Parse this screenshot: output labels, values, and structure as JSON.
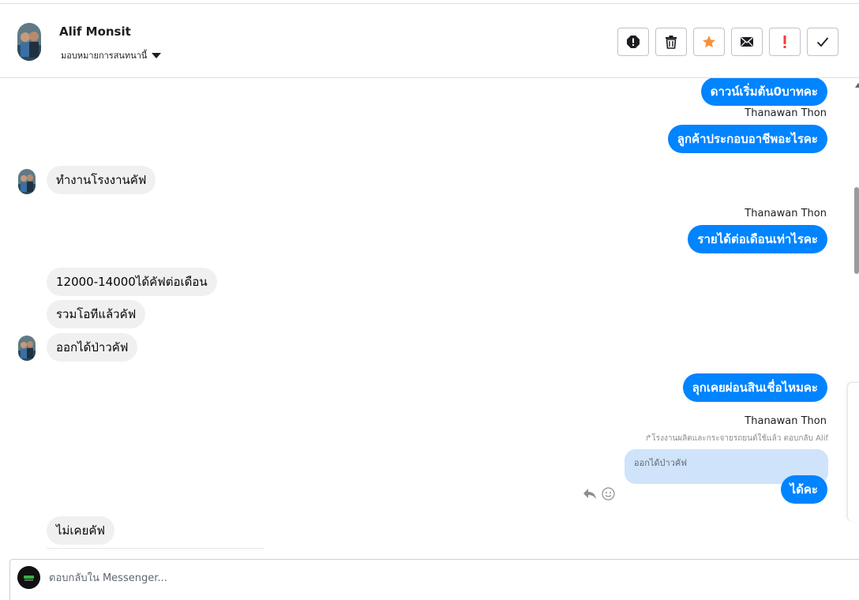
{
  "header": {
    "contact_name": "Alif Monsit",
    "assign_label": "มอบหมายการสนทนานี้",
    "actions": [
      {
        "name": "spam-button",
        "icon": "alert-circle-icon"
      },
      {
        "name": "delete-button",
        "icon": "trash-icon"
      },
      {
        "name": "star-button",
        "icon": "star-icon",
        "color": "#f7923b"
      },
      {
        "name": "email-button",
        "icon": "envelope-icon"
      },
      {
        "name": "follow-up-button",
        "icon": "exclamation-icon",
        "color": "#fa383e"
      },
      {
        "name": "done-button",
        "icon": "checkmark-icon"
      }
    ]
  },
  "messages": {
    "out1": "ดาวน์เริ่มต้น0บาทคะ",
    "sender1": "Thanawan Thon",
    "out2": "ลูกค้าประกอบอาชีพอะไรคะ",
    "in1": "ทำงานโรงงานคัฟ",
    "sender2": "Thanawan Thon",
    "out3": "รายได้ต่อเดือนเท่าไรคะ",
    "in2": "12000-14000ได้คัฟต่อเดือน",
    "in3": "รวมโอทีแล้วคัฟ",
    "in4": "ออกได้ป่าวคัฟ",
    "out4": "ลุกเคยผ่อนสินเชื่อไหมคะ",
    "sender3": "Thanawan Thon",
    "reply_hint": "โรงงานผลิตและกระจายรถยนต์ใช้แล้ว ตอบกลับ Alif",
    "quoted": "ออกได้ป่าวคัฟ",
    "out5": "ได้คะ",
    "in5": "ไม่เคยคัฟ"
  },
  "composer": {
    "placeholder": "ตอบกลับใน Messenger..."
  },
  "colors": {
    "outgoing_bubble": "#0084ff",
    "incoming_bubble": "#f0f0f0",
    "quote_bg": "#cfe4fb"
  }
}
